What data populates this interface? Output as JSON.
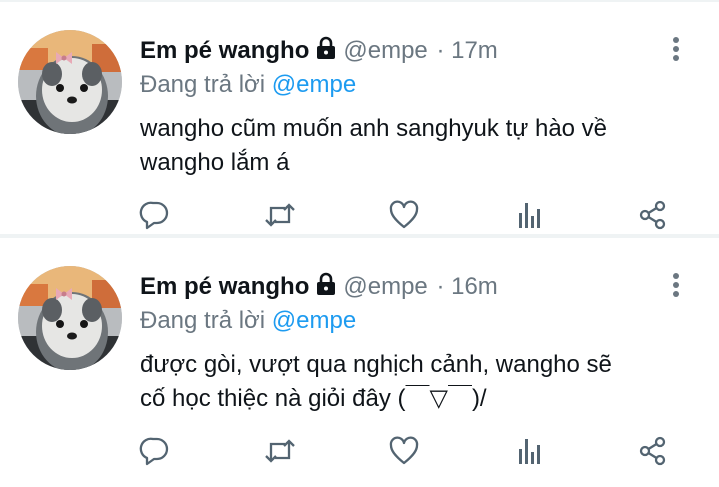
{
  "tweets": [
    {
      "author_name": "Em pé wangho",
      "handle": "@empe",
      "time": "· 17m",
      "reply_prefix": "Đang trả lời",
      "reply_to": "@empe",
      "text": "wangho cũm muốn anh sanghyuk tự hào về\nwangho lắm á"
    },
    {
      "author_name": "Em pé wangho",
      "handle": "@empe",
      "time": "· 16m",
      "reply_prefix": "Đang trả lời",
      "reply_to": "@empe",
      "text": "được gòi, vượt qua nghịch cảnh, wangho sẽ\ncố học thiệc nà giỏi đây (￣▽￣)/"
    }
  ],
  "icons": {
    "lock": "lock-icon",
    "more": "more-vertical-icon",
    "reply": "reply-icon",
    "retweet": "retweet-icon",
    "like": "heart-icon",
    "stats": "stats-icon",
    "share": "share-icon"
  },
  "colors": {
    "text": "#0f1419",
    "secondary": "#6b7781",
    "link": "#1d9bf0",
    "divider": "#eff3f4"
  }
}
